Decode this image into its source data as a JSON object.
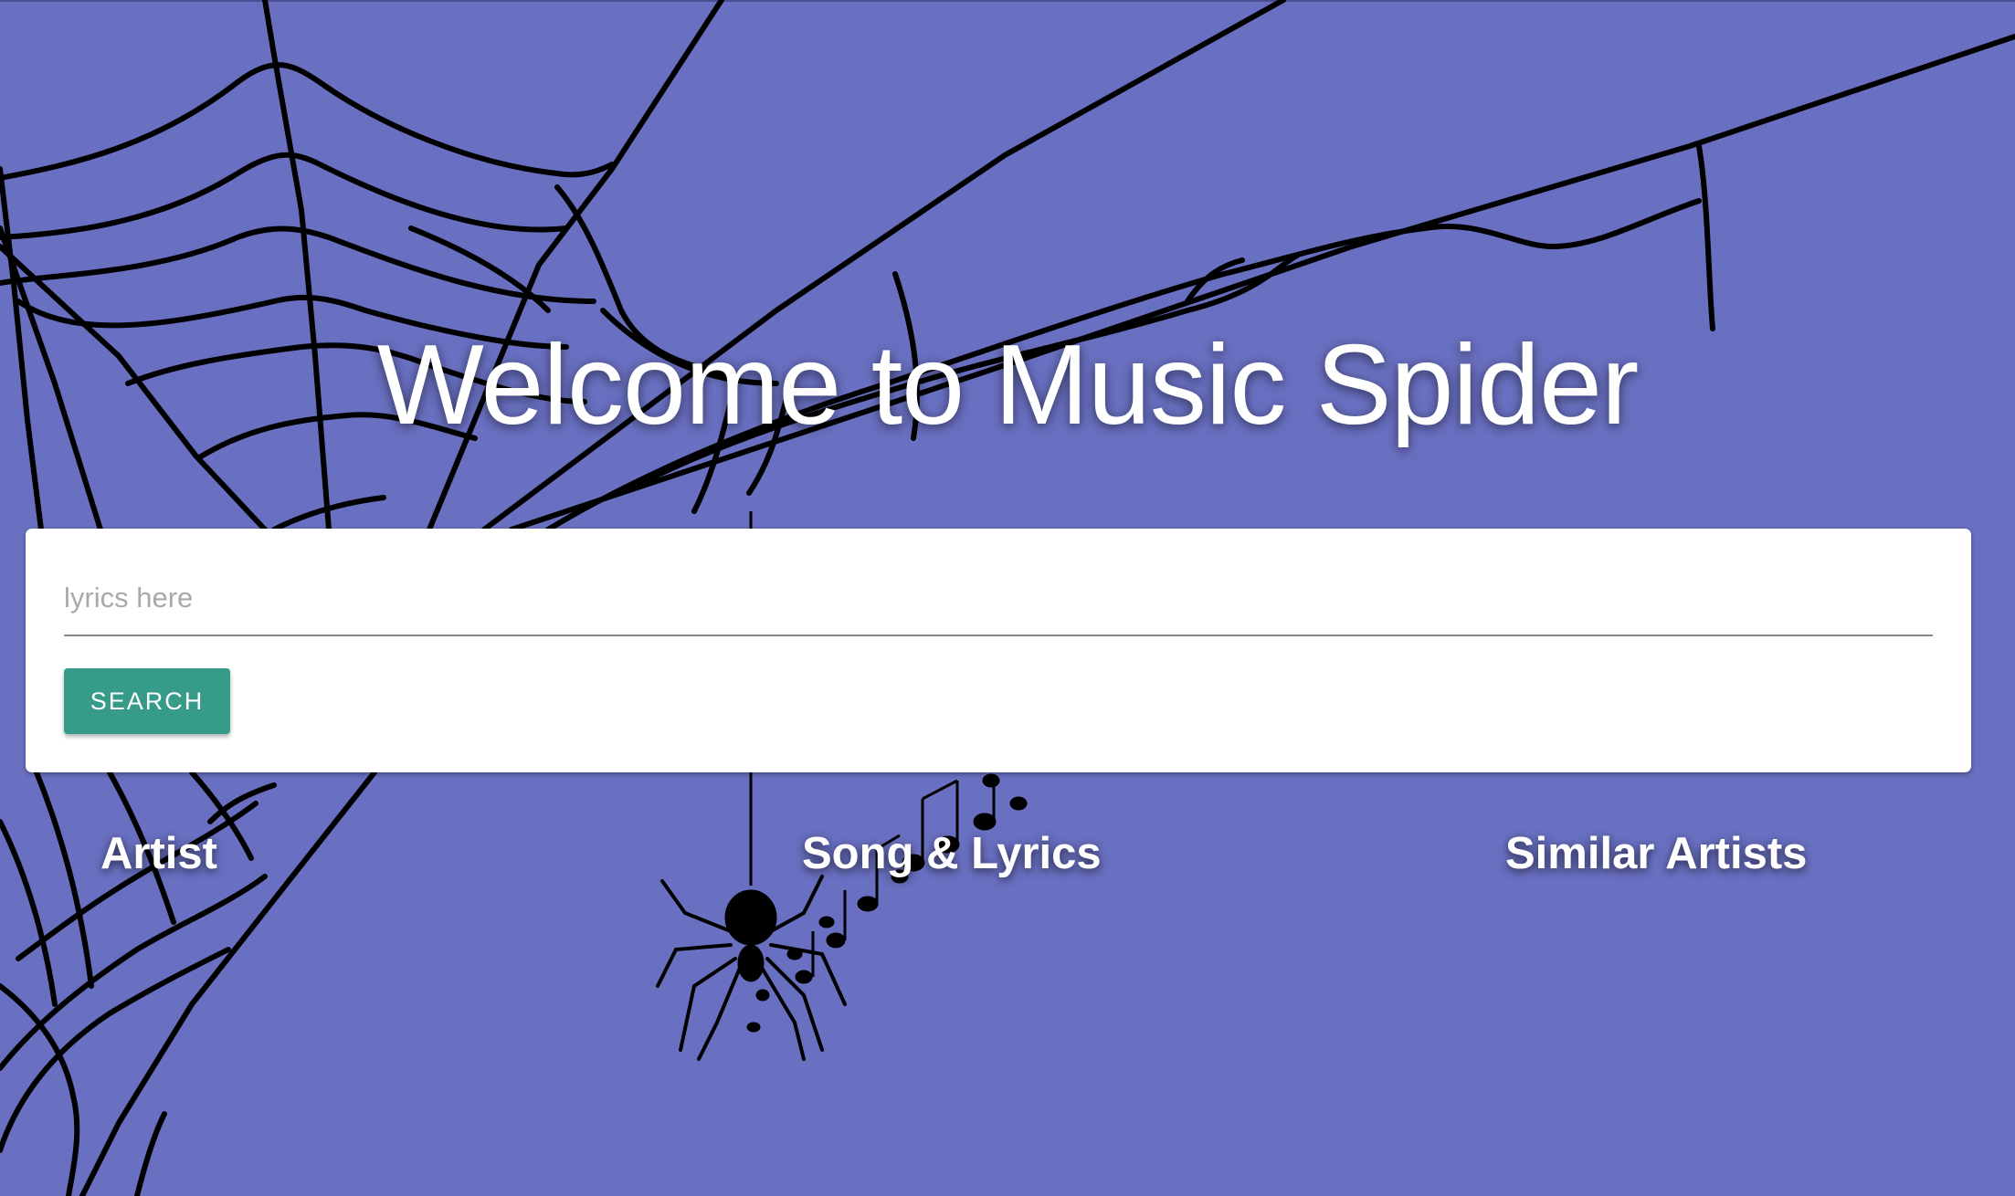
{
  "page": {
    "title": "Welcome to Music Spider",
    "background_color": "#6970c1"
  },
  "search": {
    "placeholder": "lyrics here",
    "value": "",
    "button_label": "SEARCH",
    "button_color": "#369b88"
  },
  "results": {
    "headings": [
      "Artist",
      "Song & Lyrics",
      "Similar Artists"
    ]
  },
  "decoration": {
    "background_art": "spider-web",
    "spider_icon": "spider-icon",
    "music_notes_icon": "music-notes-icon"
  }
}
